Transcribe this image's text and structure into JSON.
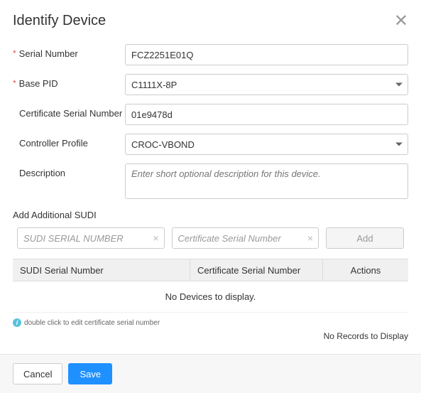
{
  "header": {
    "title": "Identify Device"
  },
  "form": {
    "serial_number": {
      "label": "Serial Number",
      "value": "FCZ2251E01Q",
      "required": true
    },
    "base_pid": {
      "label": "Base PID",
      "value": "C1111X-8P",
      "required": true
    },
    "cert_serial": {
      "label": "Certificate Serial Number",
      "value": "01e9478d"
    },
    "controller_profile": {
      "label": "Controller Profile",
      "value": "CROC-VBOND"
    },
    "description": {
      "label": "Description",
      "placeholder": "Enter short optional description for this device."
    }
  },
  "sudi": {
    "section_label": "Add Additional SUDI",
    "serial_placeholder": "SUDI SERIAL NUMBER",
    "cert_placeholder": "Certificate Serial Number",
    "add_label": "Add"
  },
  "table": {
    "col1": "SUDI Serial Number",
    "col2": "Certificate Serial Number",
    "col3": "Actions",
    "empty": "No Devices to display."
  },
  "hint": "double click to edit certificate serial number",
  "no_records": "No Records to Display",
  "footer": {
    "cancel": "Cancel",
    "save": "Save"
  }
}
